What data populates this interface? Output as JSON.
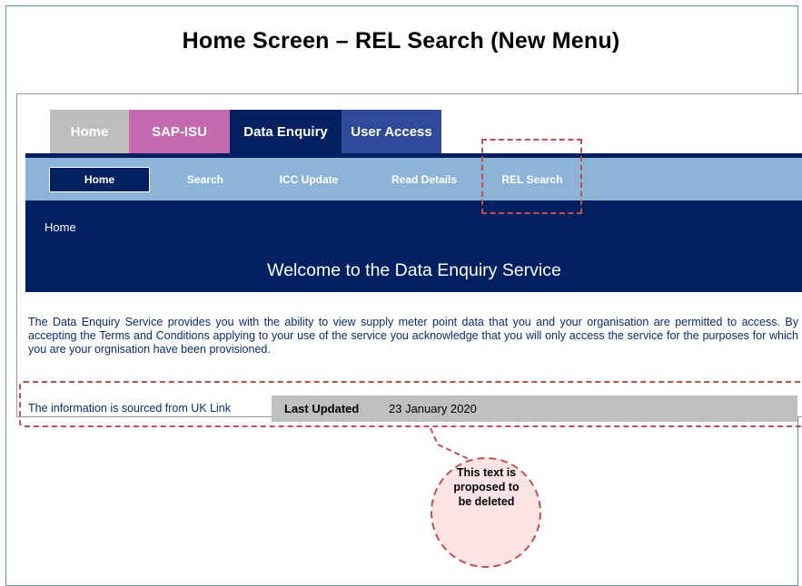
{
  "slide": {
    "title": "Home Screen – REL Search (New Menu)"
  },
  "top_tabs": [
    {
      "label": "Home"
    },
    {
      "label": "SAP-ISU"
    },
    {
      "label": "Data Enquiry"
    },
    {
      "label": "User Access"
    }
  ],
  "sub_nav": [
    {
      "label": "Home"
    },
    {
      "label": "Search"
    },
    {
      "label": "ICC Update"
    },
    {
      "label": "Read Details"
    },
    {
      "label": "REL Search"
    }
  ],
  "banner": {
    "breadcrumb": "Home",
    "welcome": "Welcome to the Data Enquiry Service"
  },
  "intro_text": "The Data Enquiry Service provides you with the ability to view supply meter point data that you and your organisation are permitted to access. By accepting the Terms and Conditions applying to your use of the service you acknowledge that you will only access the service for the purposes for which you are your orgnisation have been provisioned.",
  "info": {
    "source_text": "The information is sourced from UK Link",
    "last_updated_label": "Last Updated",
    "last_updated_date": "23 January 2020"
  },
  "callout": {
    "line1": "This text is",
    "line2": "proposed to",
    "line3": "be deleted"
  },
  "colors": {
    "navy": "#002060",
    "pink_tab": "#c56aae",
    "grey_tab": "#bdbdbd",
    "subnav_blue": "#8db4d6",
    "annotation_red": "#c0504d",
    "callout_fill": "#fbe4e3"
  }
}
